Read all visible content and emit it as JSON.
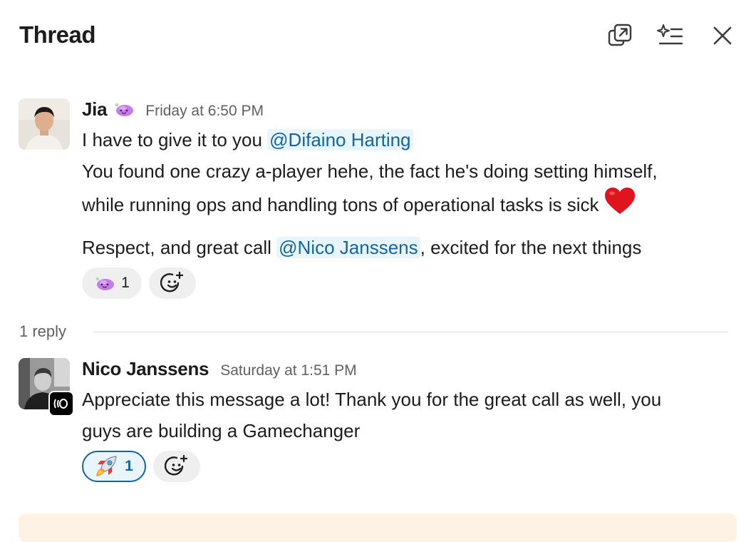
{
  "header": {
    "title": "Thread"
  },
  "messages": [
    {
      "author": "Jia",
      "status_icon": "purple-blob-emoji",
      "timestamp": "Friday at 6:50 PM",
      "line1_pre": "I have to give it to you ",
      "line1_mention": "@Difaino Harting",
      "line2": "You found one crazy a-player hehe, the fact he's doing setting himself,",
      "line3": "while running ops and handling tons of operational tasks is sick",
      "line4_pre": "Respect, and great call ",
      "line4_mention": "@Nico Janssens",
      "line4_post": ", excited for the next things",
      "reactions": [
        {
          "emoji": "purple-blob-emoji",
          "count": "1"
        }
      ]
    },
    {
      "author": "Nico Janssens",
      "timestamp": "Saturday at 1:51 PM",
      "line1": "Appreciate this message a lot! Thank you for the great call as well, you",
      "line2": "guys are building a Gamechanger",
      "reactions": [
        {
          "emoji": "rocket-emoji",
          "count": "1"
        }
      ]
    }
  ],
  "reply_divider": {
    "label": "1 reply"
  },
  "colors": {
    "mention_bg": "#e8f5fa",
    "mention_text": "#1264a3",
    "reaction_bg": "#efefef",
    "composer_bg": "#fdf2e3"
  }
}
